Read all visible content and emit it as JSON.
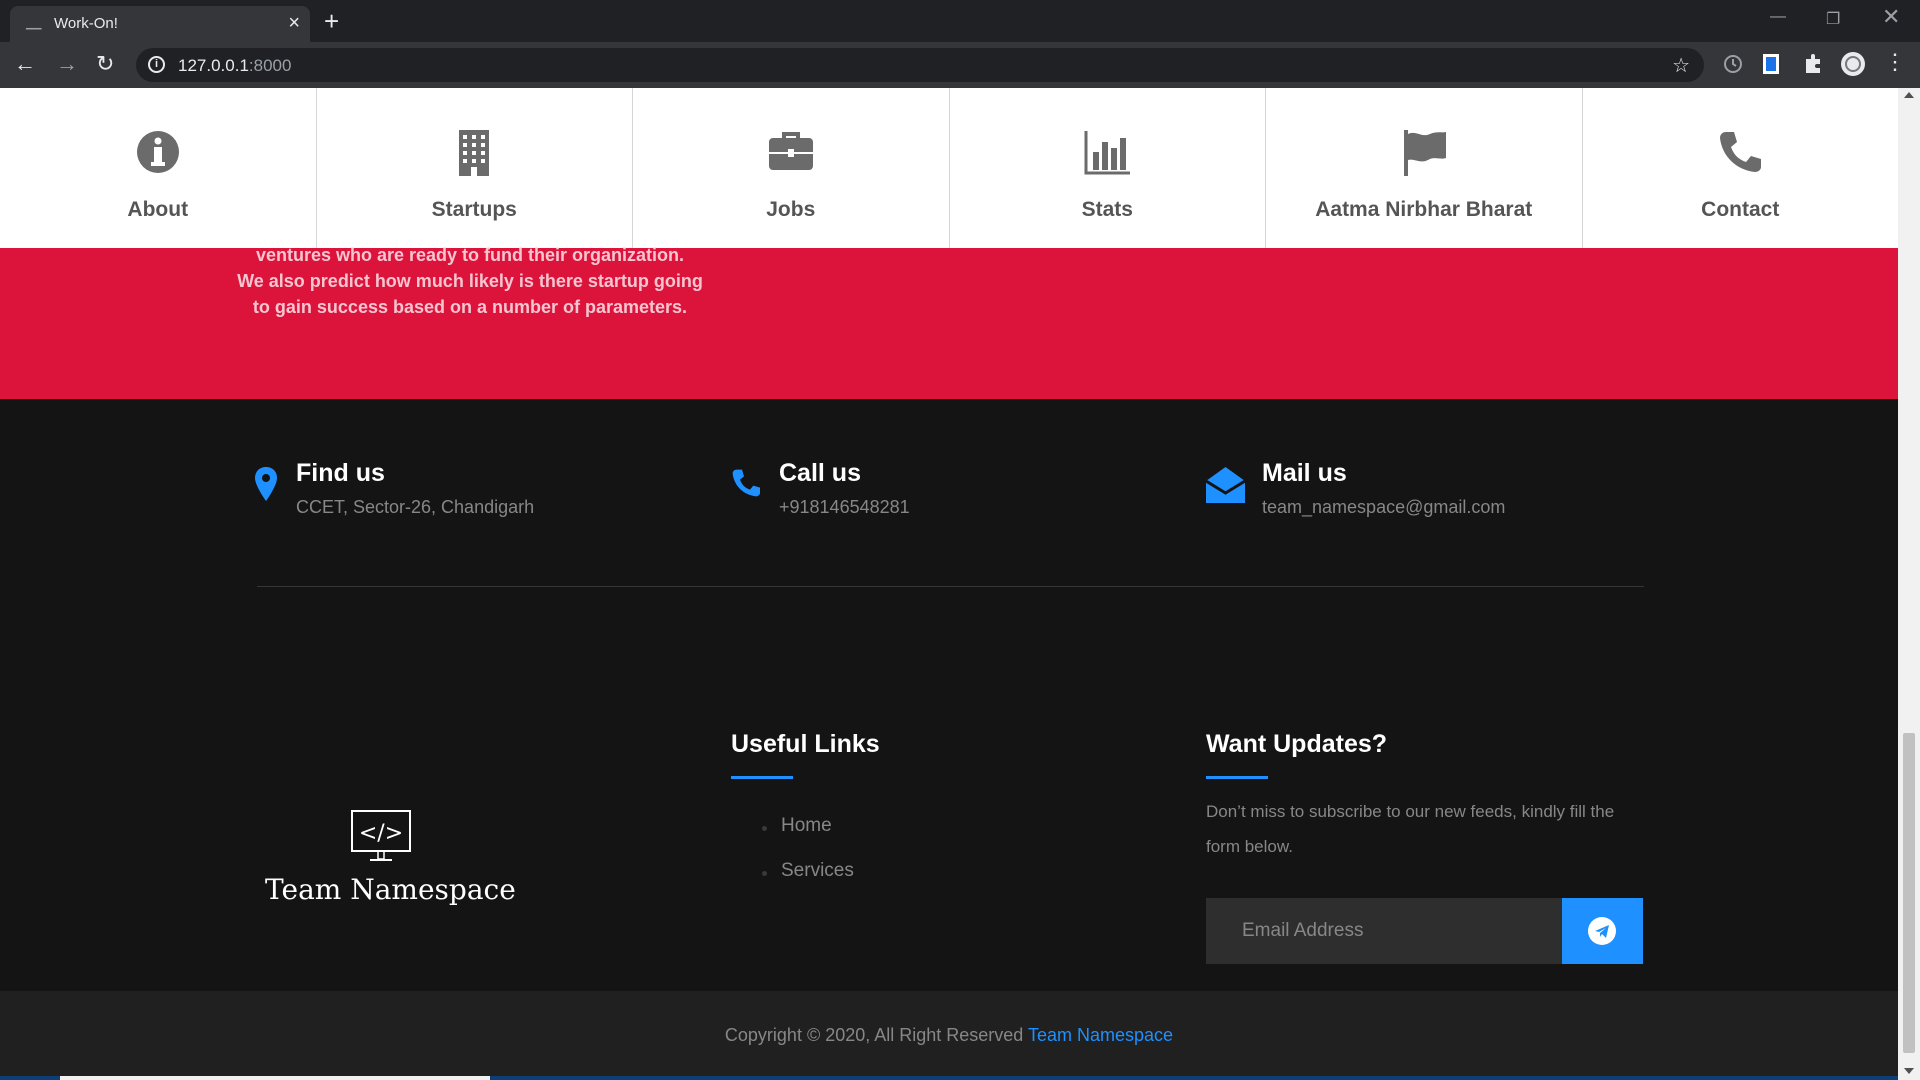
{
  "browser": {
    "tab_title": "Work-On!",
    "url_host": "127.0.0.1",
    "url_port": ":8000"
  },
  "feature_nav": {
    "items": [
      {
        "label": "About",
        "icon": "info-icon"
      },
      {
        "label": "Startups",
        "icon": "building-icon"
      },
      {
        "label": "Jobs",
        "icon": "briefcase-icon"
      },
      {
        "label": "Stats",
        "icon": "bar-chart-icon"
      },
      {
        "label": "Aatma Nirbhar Bharat",
        "icon": "flag-icon"
      },
      {
        "label": "Contact",
        "icon": "phone-icon"
      }
    ]
  },
  "hero": {
    "text_line1": "ventures who are ready to fund their organization.",
    "text_rest": "We also predict how much likely is there startup going to gain success based on a number of parameters."
  },
  "contact": {
    "find": {
      "title": "Find us",
      "detail": "CCET, Sector-26, Chandigarh"
    },
    "call": {
      "title": "Call us",
      "detail": "+918146548281"
    },
    "mail": {
      "title": "Mail us",
      "detail": "team_namespace@gmail.com"
    }
  },
  "logo": {
    "text": "Team Namespace"
  },
  "useful_links": {
    "heading": "Useful Links",
    "items": [
      "Home",
      "Services"
    ]
  },
  "updates": {
    "heading": "Want Updates?",
    "text": "Don’t miss to subscribe to our new feeds, kindly fill the form below.",
    "placeholder": "Email Address"
  },
  "copyright": {
    "text": "Copyright © 2020, All Right Reserved ",
    "brand": "Team Namespace"
  },
  "colors": {
    "accent": "#1e90ff",
    "hero_red": "#dc143c",
    "footer_bg": "#151414"
  }
}
